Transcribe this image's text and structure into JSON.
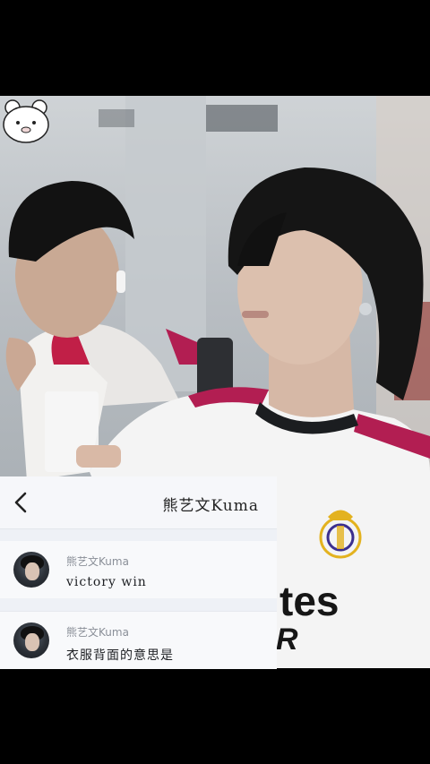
{
  "chat": {
    "header_title": "熊艺文Kuma",
    "messages": [
      {
        "author": "熊艺文Kuma",
        "text": "victory win"
      },
      {
        "author": "熊艺文Kuma",
        "text": "衣服背面的意思是"
      }
    ]
  },
  "jersey": {
    "sponsor_text": "tes",
    "sponsor_text_2": "R"
  },
  "icons": {
    "back": "chevron-left-icon",
    "sticker": "bear-face-icon",
    "crest": "club-crest-icon"
  },
  "colors": {
    "jersey_stripe": "#b21e52",
    "panel_bg": "#eef1f6",
    "crest_gold": "#e3b21f"
  }
}
